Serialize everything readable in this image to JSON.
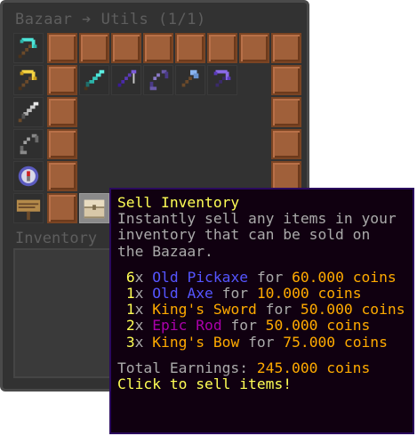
{
  "window": {
    "title": "Bazaar ➔ Utils (1/1)",
    "inventory_label": "Inventory"
  },
  "icons": {
    "col_left": [
      "diamond-pickaxe-icon",
      "golden-pickaxe-icon",
      "iron-sword-icon",
      "bow-icon",
      "compass-icon",
      "sign-icon"
    ],
    "row2": [
      "diamond-sword-icon",
      "enchanted-rod-icon",
      "bow-icon",
      "diamond-axe-icon",
      "enchanted-pickaxe-icon"
    ],
    "chest": "chest-icon"
  },
  "colors": {
    "gui_bg": "#323232",
    "slot_wood": "#a0603a",
    "tooltip_bg": "#100010",
    "tooltip_border": "#2a0a5e",
    "yellow": "#ffff55",
    "gold": "#ffaa00",
    "blue": "#5555ff",
    "purple": "#aa00aa",
    "gray": "#aaaaaa"
  },
  "tooltip": {
    "title": "Sell Inventory",
    "desc": [
      "Instantly sell any items in your",
      "inventory that can be sold on",
      "the Bazaar."
    ],
    "items": [
      {
        "qty": "6",
        "x": "x ",
        "name": "Old Pickaxe",
        "name_color": "blue",
        "for": " for ",
        "price": "60.000 coins"
      },
      {
        "qty": "1",
        "x": "x ",
        "name": "Old Axe",
        "name_color": "blue",
        "for": " for ",
        "price": "10.000 coins"
      },
      {
        "qty": "1",
        "x": "x ",
        "name": "King's Sword",
        "name_color": "gold",
        "for": " for ",
        "price": "50.000 coins"
      },
      {
        "qty": "2",
        "x": "x ",
        "name": "Epic Rod",
        "name_color": "purple",
        "for": " for ",
        "price": "50.000 coins"
      },
      {
        "qty": "3",
        "x": "x ",
        "name": "King's Bow",
        "name_color": "gold",
        "for": " for ",
        "price": "75.000 coins"
      }
    ],
    "total_label": "Total Earnings: ",
    "total_value": "245.000 coins",
    "action": "Click to sell items!"
  }
}
